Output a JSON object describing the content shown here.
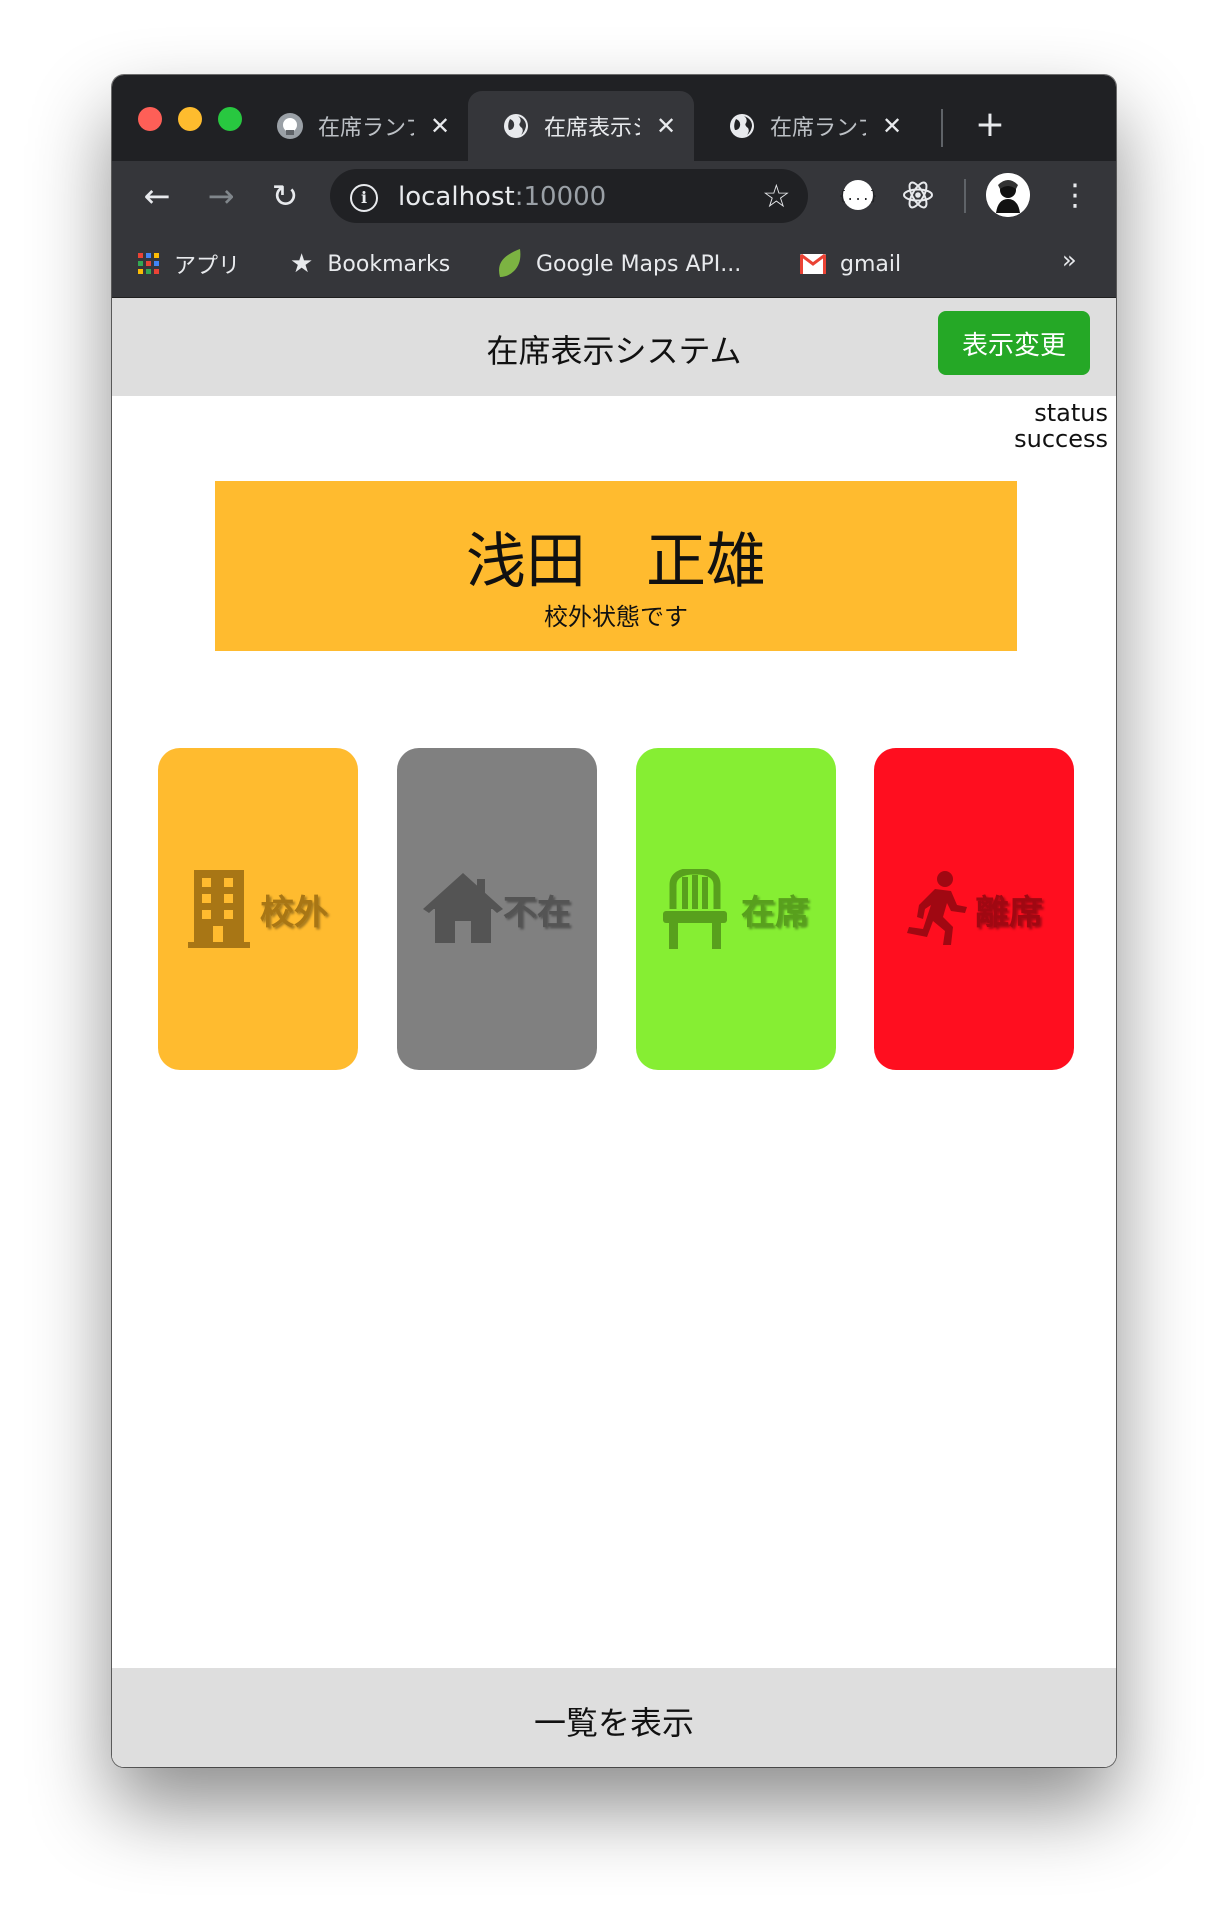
{
  "browser": {
    "tabs": [
      {
        "title": "在席ランプ",
        "close": "✕"
      },
      {
        "title": "在席表示システム",
        "close": "✕"
      },
      {
        "title": "在席ランプ",
        "close": "✕"
      }
    ],
    "new_tab": "+",
    "url_host": "localhost",
    "url_port": ":10000",
    "bookmarks": [
      {
        "label": "アプリ"
      },
      {
        "label": "Bookmarks"
      },
      {
        "label": "Google Maps API..."
      },
      {
        "label": "gmail"
      }
    ],
    "bookmarks_more": "»"
  },
  "app": {
    "header_title": "在席表示システム",
    "change_button": "表示変更",
    "status_label": "status",
    "status_value": "success",
    "person_name": "浅田　正雄",
    "current_status": "校外状態です",
    "states": [
      {
        "label": "校外",
        "icon": "building-icon",
        "color": "#ffbb2f"
      },
      {
        "label": "不在",
        "icon": "home-icon",
        "color": "#808080"
      },
      {
        "label": "在席",
        "icon": "chair-icon",
        "color": "#86ee33"
      },
      {
        "label": "離席",
        "icon": "running-person-icon",
        "color": "#ff0e1f"
      }
    ],
    "footer_link": "一覧を表示"
  },
  "colors": {
    "header_bg": "#dedede",
    "accent_green": "#25a826",
    "name_card_bg": "#ffbb2f"
  }
}
